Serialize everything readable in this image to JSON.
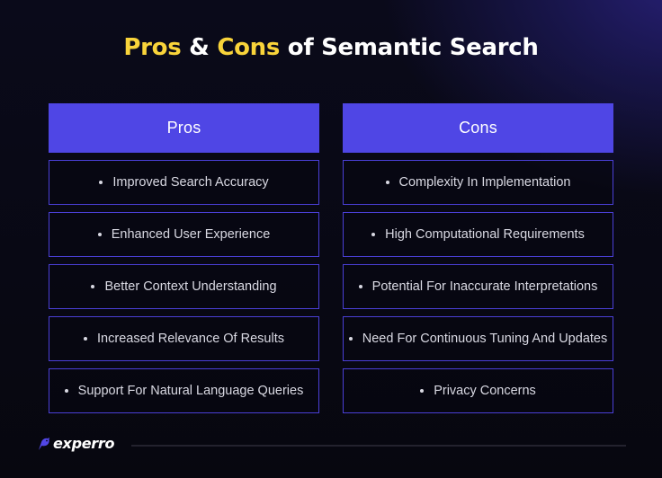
{
  "title": {
    "part1": "Pros",
    "part2": " & ",
    "part3": "Cons",
    "part4": " of Semantic Search"
  },
  "colors": {
    "accent_yellow": "#f9d43a",
    "header_blue": "#4f46e5",
    "border_blue": "#4a3fd6",
    "background": "#07070f"
  },
  "pros": {
    "header": "Pros",
    "items": [
      "Improved Search Accuracy",
      "Enhanced User Experience",
      "Better Context Understanding",
      "Increased Relevance Of Results",
      "Support For Natural Language Queries"
    ]
  },
  "cons": {
    "header": "Cons",
    "items": [
      "Complexity In Implementation",
      "High Computational Requirements",
      "Potential For Inaccurate Interpretations",
      "Need For Continuous Tuning And Updates",
      "Privacy Concerns"
    ]
  },
  "footer": {
    "brand": "experro",
    "logo_icon": "bird-icon"
  }
}
